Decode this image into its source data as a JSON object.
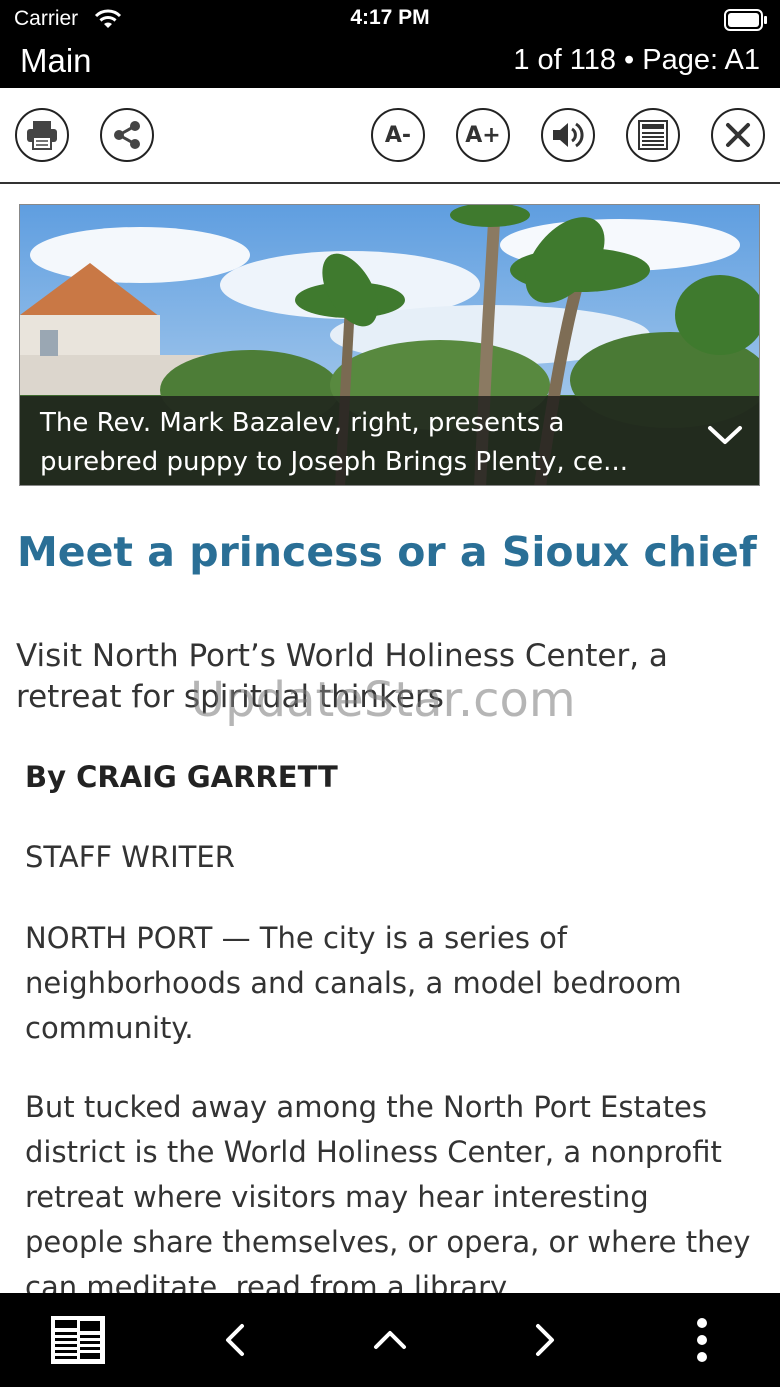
{
  "status_bar": {
    "carrier": "Carrier",
    "time": "4:17 PM"
  },
  "header": {
    "section": "Main",
    "page_info": "1 of 118 • Page: A1"
  },
  "toolbar": {
    "print_icon": "printer-icon",
    "share_icon": "share-icon",
    "font_decrease": "A-",
    "font_increase": "A+",
    "audio_icon": "speaker-icon",
    "newspaper_icon": "newspaper-icon",
    "close_icon": "close-icon"
  },
  "photo": {
    "caption": "The Rev. Mark Bazalev, right, presents a purebred puppy to Joseph Brings Plenty, ce...",
    "expand_icon": "chevron-down-icon"
  },
  "article": {
    "headline": "Meet a princess or a Sioux chief",
    "deck": "Visit North Port’s World Holiness Center, a retreat for spiritual thinkers",
    "byline": "By CRAIG GARRETT",
    "role": "STAFF WRITER",
    "paragraphs": [
      "NORTH PORT — The city is a series of neighborhoods and canals, a model bedroom community.",
      "But tucked away among the North Port Estates district is the World Holiness Center, a nonprofit retreat where visitors may hear interesting people share themselves, or opera, or where they can meditate, read from a library"
    ]
  },
  "watermark": "UpdateStar.com",
  "bottom_nav": {
    "icons": [
      "newspaper-icon",
      "chevron-left-icon",
      "chevron-up-icon",
      "chevron-right-icon",
      "more-vertical-icon"
    ]
  },
  "colors": {
    "headline": "#2a6f96",
    "bars": "#000000"
  }
}
